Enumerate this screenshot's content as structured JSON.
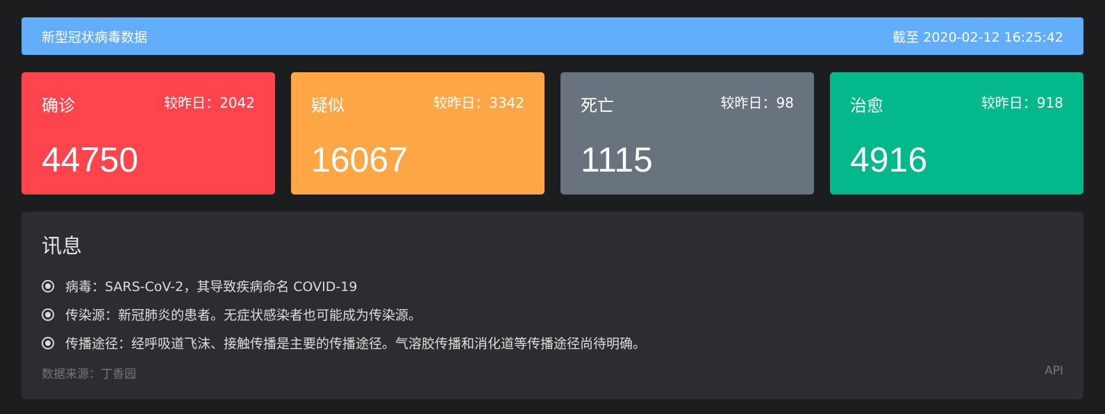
{
  "header": {
    "title": "新型冠状病毒数据",
    "timestamp": "截至 2020-02-12 16:25:42"
  },
  "cards": {
    "confirmed": {
      "label": "确诊",
      "delta": "较昨日：2042",
      "count": "44750",
      "color": "#ff444d"
    },
    "suspected": {
      "label": "疑似",
      "delta": "较昨日：3342",
      "count": "16067",
      "color": "#ffa646"
    },
    "dead": {
      "label": "死亡",
      "delta": "较昨日：98",
      "count": "1115",
      "color": "#68737e"
    },
    "cured": {
      "label": "治愈",
      "delta": "较昨日：918",
      "count": "4916",
      "color": "#03b88b"
    }
  },
  "info": {
    "title": "讯息",
    "items": [
      "病毒：SARS-CoV-2，其导致疾病命名 COVID-19",
      "传染源：新冠肺炎的患者。无症状感染者也可能成为传染源。",
      "传播途径：经呼吸道飞沫、接触传播是主要的传播途径。气溶胶传播和消化道等传播途径尚待明确。"
    ],
    "source": "数据来源：丁香园",
    "api_label": "API"
  },
  "colors": {
    "header_bg": "#63adfd",
    "page_bg": "#1c1d1f",
    "panel_bg": "#2c2d30"
  },
  "icons": {
    "list_bullet": "radio-icon"
  }
}
